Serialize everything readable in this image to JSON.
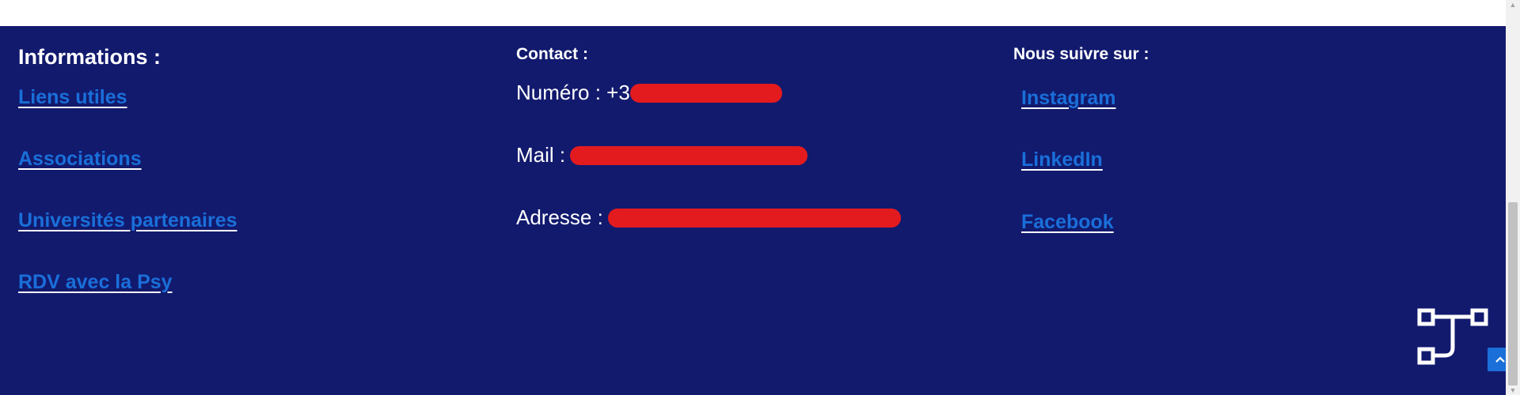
{
  "info": {
    "heading": "Informations :",
    "links": [
      "Liens utiles",
      "Associations",
      "Universités partenaires",
      "RDV avec la Psy"
    ]
  },
  "contact": {
    "heading": "Contact :",
    "phone_label": "Numéro : +3",
    "mail_label": "Mail :",
    "address_label": "Adresse :"
  },
  "social": {
    "heading": "Nous suivre sur :",
    "links": [
      "Instagram",
      "LinkedIn",
      "Facebook"
    ]
  },
  "icons": {
    "workflow": "workflow-diagram-icon",
    "back_to_top": "chevron-up-icon"
  },
  "colors": {
    "footer_bg": "#121a6e",
    "link": "#1a6fd9",
    "redaction": "#e31b1f"
  }
}
